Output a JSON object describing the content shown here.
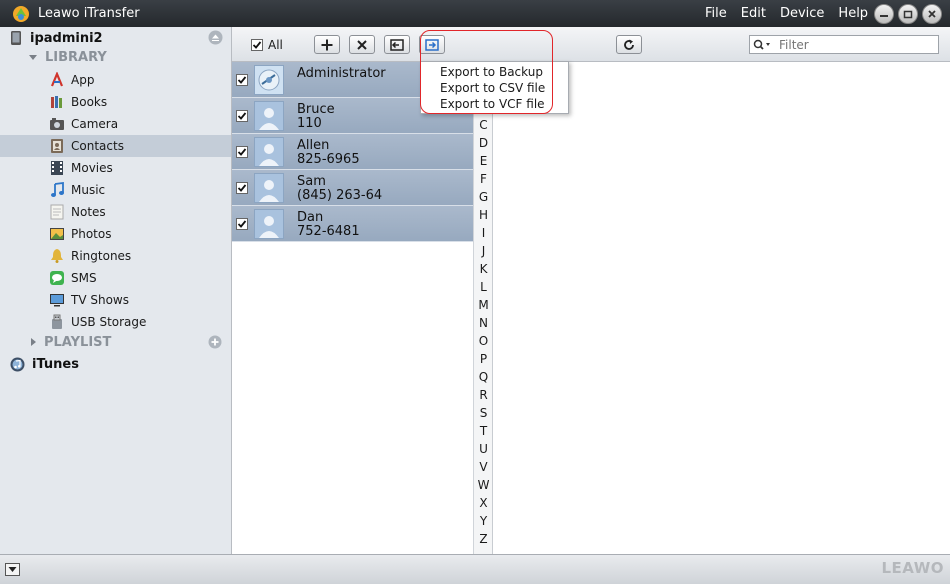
{
  "window": {
    "title": "Leawo iTransfer"
  },
  "menu": [
    "File",
    "Edit",
    "Device",
    "Help"
  ],
  "sidebar": {
    "device": "ipadmini2",
    "library_label": "LIBRARY",
    "items": [
      {
        "label": "App",
        "icon": "app-store-icon"
      },
      {
        "label": "Books",
        "icon": "books-icon"
      },
      {
        "label": "Camera",
        "icon": "camera-icon"
      },
      {
        "label": "Contacts",
        "icon": "contacts-icon",
        "selected": true
      },
      {
        "label": "Movies",
        "icon": "film-icon"
      },
      {
        "label": "Music",
        "icon": "music-note-icon"
      },
      {
        "label": "Notes",
        "icon": "notes-icon"
      },
      {
        "label": "Photos",
        "icon": "photo-icon"
      },
      {
        "label": "Ringtones",
        "icon": "bell-icon"
      },
      {
        "label": "SMS",
        "icon": "sms-icon"
      },
      {
        "label": "TV Shows",
        "icon": "tv-icon"
      },
      {
        "label": "USB Storage",
        "icon": "usb-icon"
      }
    ],
    "playlist_label": "PLAYLIST",
    "itunes_label": "iTunes"
  },
  "toolbar": {
    "all_label": "All",
    "search_placeholder": "Filter"
  },
  "contacts": [
    {
      "name": "Administrator",
      "phone": "",
      "checked": true
    },
    {
      "name": "Bruce",
      "phone": "110",
      "checked": true
    },
    {
      "name": "Allen",
      "phone": "825-6965",
      "checked": true
    },
    {
      "name": "Sam",
      "phone": "(845) 263-64",
      "checked": true
    },
    {
      "name": "Dan",
      "phone": "752-6481",
      "checked": true
    }
  ],
  "alphabet": [
    "C",
    "D",
    "E",
    "F",
    "G",
    "H",
    "I",
    "J",
    "K",
    "L",
    "M",
    "N",
    "O",
    "P",
    "Q",
    "R",
    "S",
    "T",
    "U",
    "V",
    "W",
    "X",
    "Y",
    "Z"
  ],
  "export_menu": [
    "Export to Backup",
    "Export to CSV file",
    "Export to VCF file"
  ],
  "statusbar": {
    "brand": "LEAWO"
  },
  "colors": {
    "highlight": "#e1262a",
    "row_selected": "#c4cdd8",
    "titlebar": "#2c3035"
  }
}
